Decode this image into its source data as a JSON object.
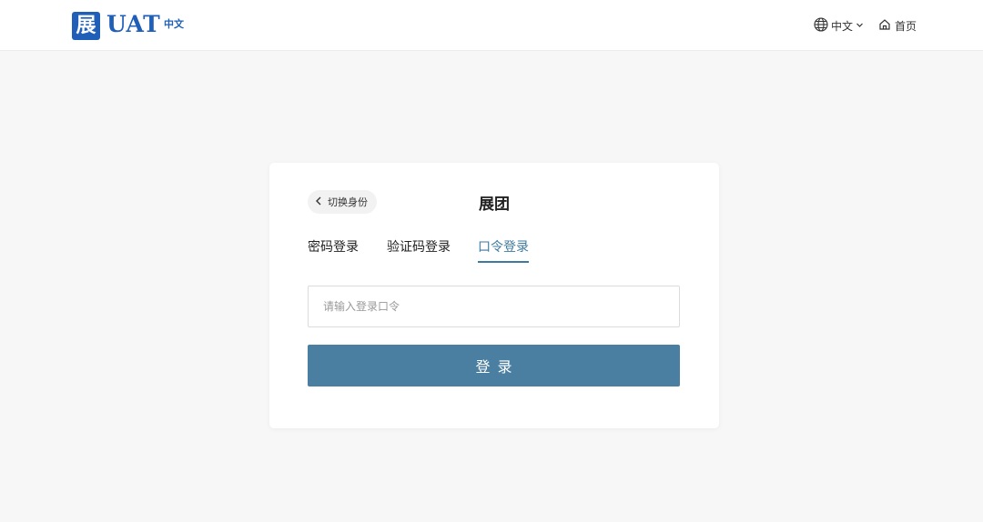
{
  "header": {
    "logo_mark": "展",
    "logo_text": "UAT",
    "logo_sub": "中文",
    "language_label": "中文",
    "home_label": "首页"
  },
  "login": {
    "back_label": "切换身份",
    "title": "展团",
    "tabs": [
      {
        "label": "密码登录",
        "active": false
      },
      {
        "label": "验证码登录",
        "active": false
      },
      {
        "label": "口令登录",
        "active": true
      }
    ],
    "input_placeholder": "请输入登录口令",
    "input_value": "",
    "submit_label": "登录"
  },
  "colors": {
    "brand": "#1f5fb8",
    "accent": "#3d7aa0",
    "button": "#4a7fa1",
    "page_bg": "#f7f7f8"
  },
  "icons": {
    "language": "globe-icon",
    "language_dropdown": "chevron-down-icon",
    "home": "home-icon",
    "back": "chevron-left-icon"
  }
}
